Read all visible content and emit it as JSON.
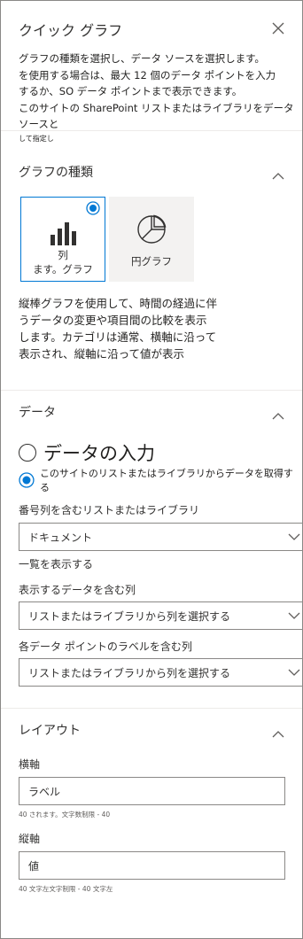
{
  "panel": {
    "title": "クイック グラフ",
    "description": {
      "line1": "グラフの種類を選択し、データ ソースを選択します。",
      "line2": "を使用する場合は、最大 12 個のデータ ポイントを入力",
      "line3": "するか、SO データ ポイントまで表示できます。",
      "line4": "このサイトの SharePoint リストまたはライブラリをデータ ソースと",
      "line5": "して指定し"
    }
  },
  "chart_type": {
    "section_title": "グラフの種類",
    "options": [
      {
        "label_line1": "列",
        "label_line2": "ます。グラフ",
        "icon": "column-chart-icon",
        "selected": true
      },
      {
        "label": "円グラフ",
        "icon": "pie-chart-icon",
        "selected": false
      }
    ],
    "description": {
      "line1": "縦棒グラフを使用して、時間の経過に伴",
      "line2": "うデータの変更や項目間の比較を表示",
      "line3": "します。カテゴリは通常、横軸に沿って",
      "line4": "表示され、縦軸に沿って値が表示"
    }
  },
  "data": {
    "section_title": "データ",
    "option_enter": "データの入力",
    "option_list": "このサイトのリストまたはライブラリからデータを取得する",
    "selected_option": "list",
    "list_label": "番号列を含むリストまたはライブラリ",
    "list_value": "ドキュメント",
    "view_list_link": "一覧を表示する",
    "column_label": "表示するデータを含む列",
    "column_value": "リストまたはライブラリから列を選択する",
    "label_column_label": "各データ ポイントのラベルを含む列",
    "label_column_value": "リストまたはライブラリから列を選択する"
  },
  "layout": {
    "section_title": "レイアウト",
    "x_axis_label": "横軸",
    "x_axis_value": "ラベル",
    "x_axis_hint": "40 されます。文字数制限 - 40",
    "y_axis_label": "縦軸",
    "y_axis_value": "値",
    "y_axis_hint": "40 文字左文字制限 - 40 文字左"
  },
  "colors": {
    "accent": "#0078d4",
    "text": "#323130",
    "border": "#8a8886",
    "tile_bg": "#f3f2f1"
  }
}
